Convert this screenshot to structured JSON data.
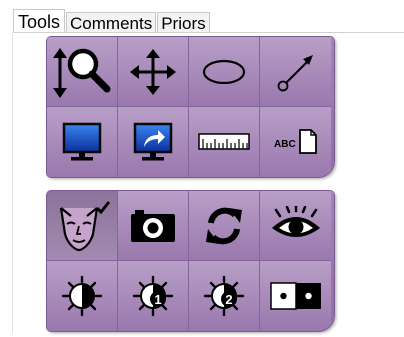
{
  "tabs": [
    {
      "label": "Tools",
      "active": true
    },
    {
      "label": "Comments",
      "active": false
    },
    {
      "label": "Priors",
      "active": false
    }
  ],
  "tool_groups": [
    {
      "name": "image-tools",
      "tools": [
        {
          "icon": "zoom-pan-icon"
        },
        {
          "icon": "move-arrows-icon"
        },
        {
          "icon": "ellipse-icon"
        },
        {
          "icon": "arrow-annotation-icon"
        },
        {
          "icon": "monitor-icon"
        },
        {
          "icon": "share-monitor-icon"
        },
        {
          "icon": "ruler-icon"
        },
        {
          "icon": "text-annotation-icon",
          "text": "ABC"
        }
      ]
    },
    {
      "name": "display-tools",
      "tools": [
        {
          "icon": "face-check-icon",
          "pressed": true
        },
        {
          "icon": "camera-icon"
        },
        {
          "icon": "refresh-icon"
        },
        {
          "icon": "eye-icon"
        },
        {
          "icon": "contrast-icon"
        },
        {
          "icon": "contrast-1-icon",
          "text": "1"
        },
        {
          "icon": "contrast-2-icon",
          "text": "2"
        },
        {
          "icon": "pixel-dots-icon"
        }
      ]
    }
  ],
  "colors": {
    "panel": "#9a78ae",
    "panel_light": "#b89fc7",
    "panel_border": "#7b5a92",
    "monitor_blue": "#1c5bd6"
  }
}
